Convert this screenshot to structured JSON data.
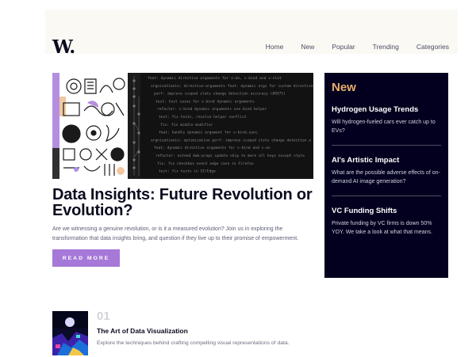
{
  "logo": {
    "text": "W."
  },
  "nav": {
    "items": [
      "Home",
      "New",
      "Popular",
      "Trending",
      "Categories"
    ]
  },
  "hero": {
    "image": {
      "terminal_lines": [
        "feat: dynamic directive arguments for v-on, v-bind and v-slot",
        "orgnizationio: directive-arguments  feat: dynamic args for custom directives",
        "perf: improve scoped slots change detection accuracy (#9371)",
        "test: test cases for v-bind dynamic arguments",
        "refactor: v-bind dynamic arguments use bind helper",
        "test: fix tests, resolve helper conflict",
        "fix: fix middle modifier",
        "feat: handle dynamic argument for v-bind.sync",
        "orgnizationio: optimization  perf: improve scoped slots change detection a",
        "feat: dynamic directive arguments for v-bind and v-on",
        "refactor: extend dom-props update skip to more all keys except style",
        "fix: fix checkbox event edge case in Firefox",
        "test: fix tests in IE/Edge"
      ]
    },
    "title": "Data Insights: Future Revolution or Evolution?",
    "description": "Are we witnessing a genuine revolution, or is it a measured evolution? Join us in exploring the transformation that data insights bring, and question if they live up to their promise of empowerment.",
    "button_label": "READ MORE"
  },
  "new_panel": {
    "heading": "New",
    "items": [
      {
        "title": "Hydrogen Usage Trends",
        "text": "Will hydrogen-fueled cars ever catch up to EVs?"
      },
      {
        "title": "AI's Artistic Impact",
        "text": "What are the possible adverse effects of on-demand AI image generation?"
      },
      {
        "title": "VC Funding Shifts",
        "text": "Private funding by VC firms is down 50% YOY. We take a look at what that means."
      }
    ]
  },
  "list": [
    {
      "number": "01",
      "title": "The Art of Data Visualization",
      "description": "Explore the techniques behind crafting compelling visual representations of data."
    }
  ],
  "colors": {
    "accent": "#a678d8",
    "panel_bg": "#02001e",
    "panel_heading": "#e9ad6a",
    "header_bg": "#fbf9f4",
    "text_dark": "#0b0b1f"
  }
}
